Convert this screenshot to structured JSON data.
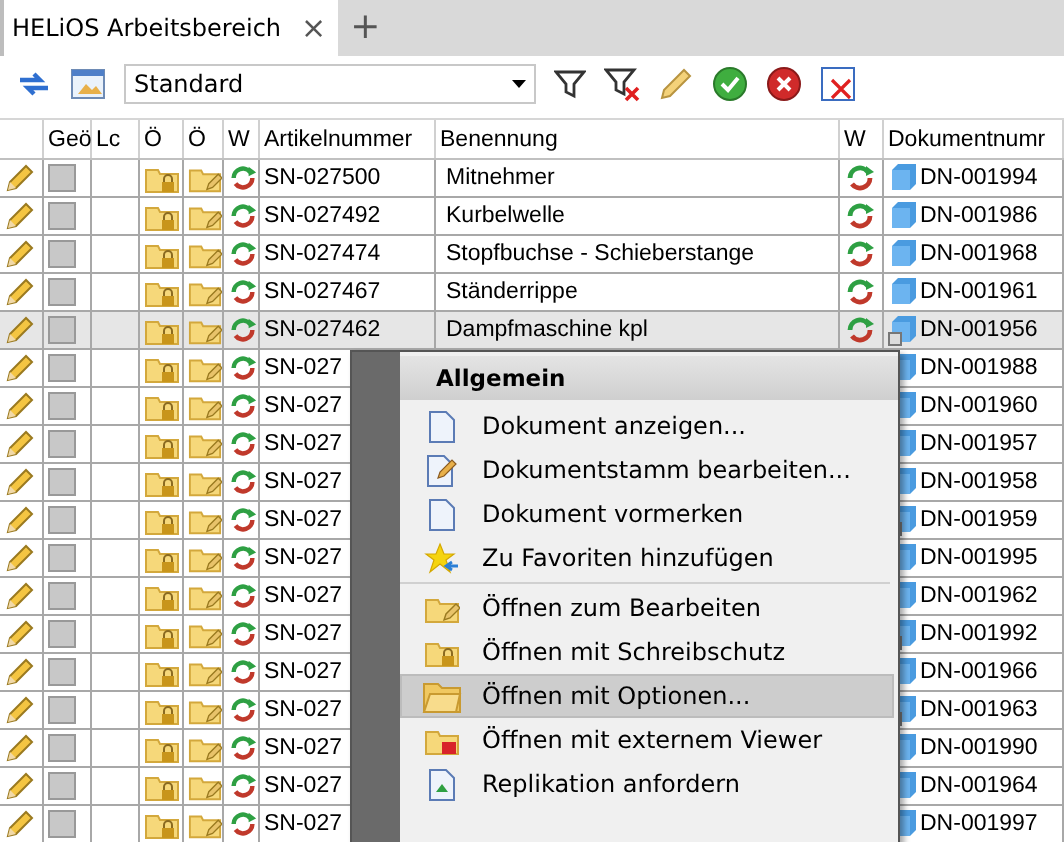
{
  "tabs": [
    {
      "label": "HELiOS Arbeitsbereich",
      "selected": true,
      "close": "×"
    }
  ],
  "new_tab": "+",
  "toolbar": {
    "view": "Standard"
  },
  "table": {
    "columns": [
      "Geö",
      "Lc",
      "Ö",
      "Ö",
      "W",
      "Artikelnummer",
      "Benennung",
      "W",
      "Dokumentnumr"
    ],
    "rows": [
      {
        "article": "SN-027500",
        "name": "Mitnehmer",
        "doc": "DN-001994",
        "reference": false,
        "selected": false
      },
      {
        "article": "SN-027492",
        "name": "Kurbelwelle",
        "doc": "DN-001986",
        "reference": false,
        "selected": false
      },
      {
        "article": "SN-027474",
        "name": "Stopfbuchse - Schieberstange",
        "doc": "DN-001968",
        "reference": false,
        "selected": false
      },
      {
        "article": "SN-027467",
        "name": "Ständerrippe",
        "doc": "DN-001961",
        "reference": false,
        "selected": false
      },
      {
        "article": "SN-027462",
        "name": "Dampfmaschine kpl",
        "doc": "DN-001956",
        "reference": true,
        "selected": true
      },
      {
        "article": "SN-027",
        "doc": "DN-001988",
        "reference": false,
        "selected": false
      },
      {
        "article": "SN-027",
        "doc": "DN-001960",
        "reference": false,
        "selected": false
      },
      {
        "article": "SN-027",
        "doc": "DN-001957",
        "reference": false,
        "selected": false
      },
      {
        "article": "SN-027",
        "doc": "DN-001958",
        "reference": false,
        "selected": false
      },
      {
        "article": "SN-027",
        "doc": "DN-001959",
        "reference": true,
        "selected": false
      },
      {
        "article": "SN-027",
        "doc": "DN-001995",
        "reference": false,
        "selected": false
      },
      {
        "article": "SN-027",
        "doc": "DN-001962",
        "reference": false,
        "selected": false
      },
      {
        "article": "SN-027",
        "doc": "DN-001992",
        "reference": true,
        "selected": false
      },
      {
        "article": "SN-027",
        "doc": "DN-001966",
        "reference": false,
        "selected": false
      },
      {
        "article": "SN-027",
        "doc": "DN-001963",
        "reference": true,
        "selected": false
      },
      {
        "article": "SN-027",
        "doc": "DN-001990",
        "reference": false,
        "selected": false
      },
      {
        "article": "SN-027",
        "doc": "DN-001964",
        "reference": false,
        "selected": false
      },
      {
        "article": "SN-027",
        "doc": "DN-001997",
        "reference": false,
        "selected": false
      }
    ]
  },
  "context_menu": {
    "header": "Allgemein",
    "items": [
      {
        "label": "Dokument anzeigen...",
        "kind": "document",
        "selected": false,
        "separator_before": false
      },
      {
        "label": "Dokumentstamm bearbeiten...",
        "kind": "edit",
        "selected": false,
        "separator_before": false
      },
      {
        "label": "Dokument vormerken",
        "kind": "document",
        "selected": false,
        "separator_before": false
      },
      {
        "label": "Zu Favoriten hinzufügen",
        "kind": "favorite",
        "selected": false,
        "separator_before": false
      },
      {
        "label": "Öffnen zum Bearbeiten",
        "kind": "folderedit",
        "selected": false,
        "separator_before": true
      },
      {
        "label": "Öffnen mit Schreibschutz",
        "kind": "folderlock",
        "selected": false,
        "separator_before": false
      },
      {
        "label": "Öffnen mit Optionen...",
        "kind": "folder",
        "selected": true,
        "separator_before": false
      },
      {
        "label": "Öffnen mit externem Viewer",
        "kind": "folderviewer",
        "selected": false,
        "separator_before": false
      },
      {
        "label": "Replikation anfordern",
        "kind": "replication",
        "selected": false,
        "separator_before": false
      }
    ]
  }
}
